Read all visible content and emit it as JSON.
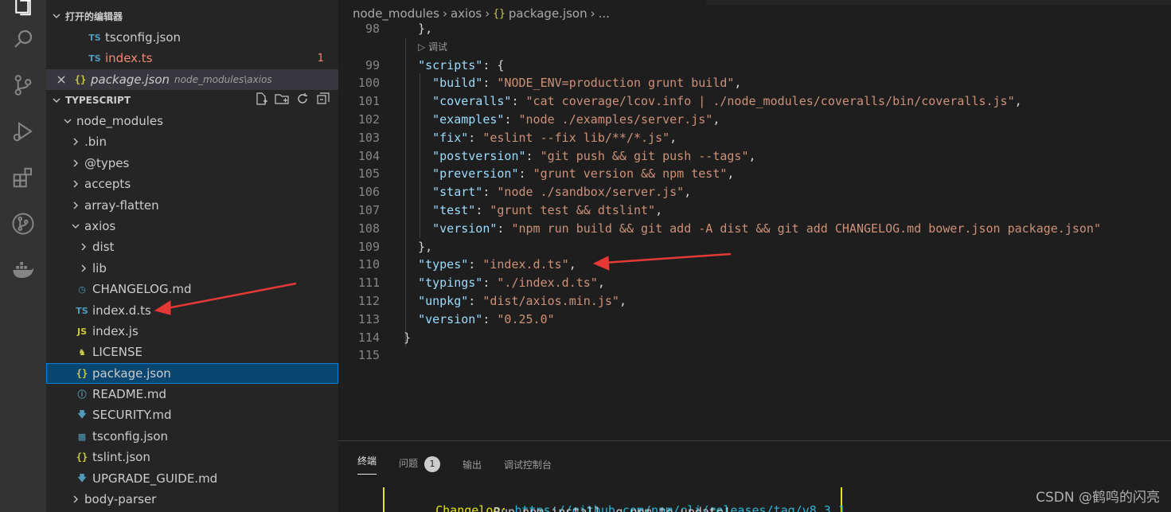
{
  "sidebar": {
    "open_editors_title": "打开的编辑器",
    "open_editors": [
      {
        "icon": "TS",
        "name": "tsconfig.json",
        "modified": false
      },
      {
        "icon": "TS",
        "name": "index.ts",
        "problems": "1"
      },
      {
        "icon": "{}",
        "name": "package.json",
        "path": "node_modules\\axios"
      }
    ],
    "workspace_title": "TYPESCRIPT",
    "tree": [
      {
        "label": "node_modules"
      },
      {
        "label": ".bin"
      },
      {
        "label": "@types"
      },
      {
        "label": "accepts"
      },
      {
        "label": "array-flatten"
      },
      {
        "label": "axios"
      },
      {
        "label": "dist"
      },
      {
        "label": "lib"
      },
      {
        "label": "CHANGELOG.md"
      },
      {
        "label": "index.d.ts"
      },
      {
        "label": "index.js"
      },
      {
        "label": "LICENSE"
      },
      {
        "label": "package.json"
      },
      {
        "label": "README.md"
      },
      {
        "label": "SECURITY.md"
      },
      {
        "label": "tsconfig.json"
      },
      {
        "label": "tslint.json"
      },
      {
        "label": "UPGRADE_GUIDE.md"
      },
      {
        "label": "body-parser"
      }
    ]
  },
  "breadcrumb": {
    "seg1": "node_modules",
    "seg2": "axios",
    "seg3": "package.json",
    "seg4": "..."
  },
  "editor": {
    "codelens": "调试",
    "lines": [
      {
        "n": "98",
        "text": "  },"
      },
      {
        "n": "99",
        "key": "\"scripts\"",
        "rest": ": {"
      },
      {
        "n": "100",
        "key": "\"build\"",
        "val": "\"NODE_ENV=production grunt build\"",
        "end": ","
      },
      {
        "n": "101",
        "key": "\"coveralls\"",
        "val": "\"cat coverage/lcov.info | ./node_modules/coveralls/bin/coveralls.js\"",
        "end": ","
      },
      {
        "n": "102",
        "key": "\"examples\"",
        "val": "\"node ./examples/server.js\"",
        "end": ","
      },
      {
        "n": "103",
        "key": "\"fix\"",
        "val": "\"eslint --fix lib/**/*.js\"",
        "end": ","
      },
      {
        "n": "104",
        "key": "\"postversion\"",
        "val": "\"git push && git push --tags\"",
        "end": ","
      },
      {
        "n": "105",
        "key": "\"preversion\"",
        "val": "\"grunt version && npm test\"",
        "end": ","
      },
      {
        "n": "106",
        "key": "\"start\"",
        "val": "\"node ./sandbox/server.js\"",
        "end": ","
      },
      {
        "n": "107",
        "key": "\"test\"",
        "val": "\"grunt test && dtslint\"",
        "end": ","
      },
      {
        "n": "108",
        "key": "\"version\"",
        "val": "\"npm run build && git add -A dist && git add CHANGELOG.md bower.json package.json\"",
        "end": ""
      },
      {
        "n": "109",
        "text": "  },"
      },
      {
        "n": "110",
        "key": "\"types\"",
        "val": "\"index.d.ts\"",
        "end": ","
      },
      {
        "n": "111",
        "key": "\"typings\"",
        "val": "\"./index.d.ts\"",
        "end": ","
      },
      {
        "n": "112",
        "key": "\"unpkg\"",
        "val": "\"dist/axios.min.js\"",
        "end": ","
      },
      {
        "n": "113",
        "key": "\"version\"",
        "val": "\"0.25.0\"",
        "end": ""
      },
      {
        "n": "114",
        "text": "}"
      },
      {
        "n": "115",
        "text": ""
      }
    ]
  },
  "panel": {
    "tabs": [
      {
        "label": "终端"
      },
      {
        "label": "问题",
        "badge": "1"
      },
      {
        "label": "输出"
      },
      {
        "label": "调试控制台"
      }
    ],
    "terminal_label": "Changelog:",
    "terminal_link": "https://github.com/npm/cli/releases/tag/v8.3.1",
    "terminal_line2": "Run npm install -g npm to update!"
  },
  "watermark": "CSDN @鹤鸣的闪亮",
  "colors": {
    "selection": "#094771",
    "json_key": "#9cdcfe",
    "json_string": "#ce9178",
    "arrow": "#e53935"
  }
}
